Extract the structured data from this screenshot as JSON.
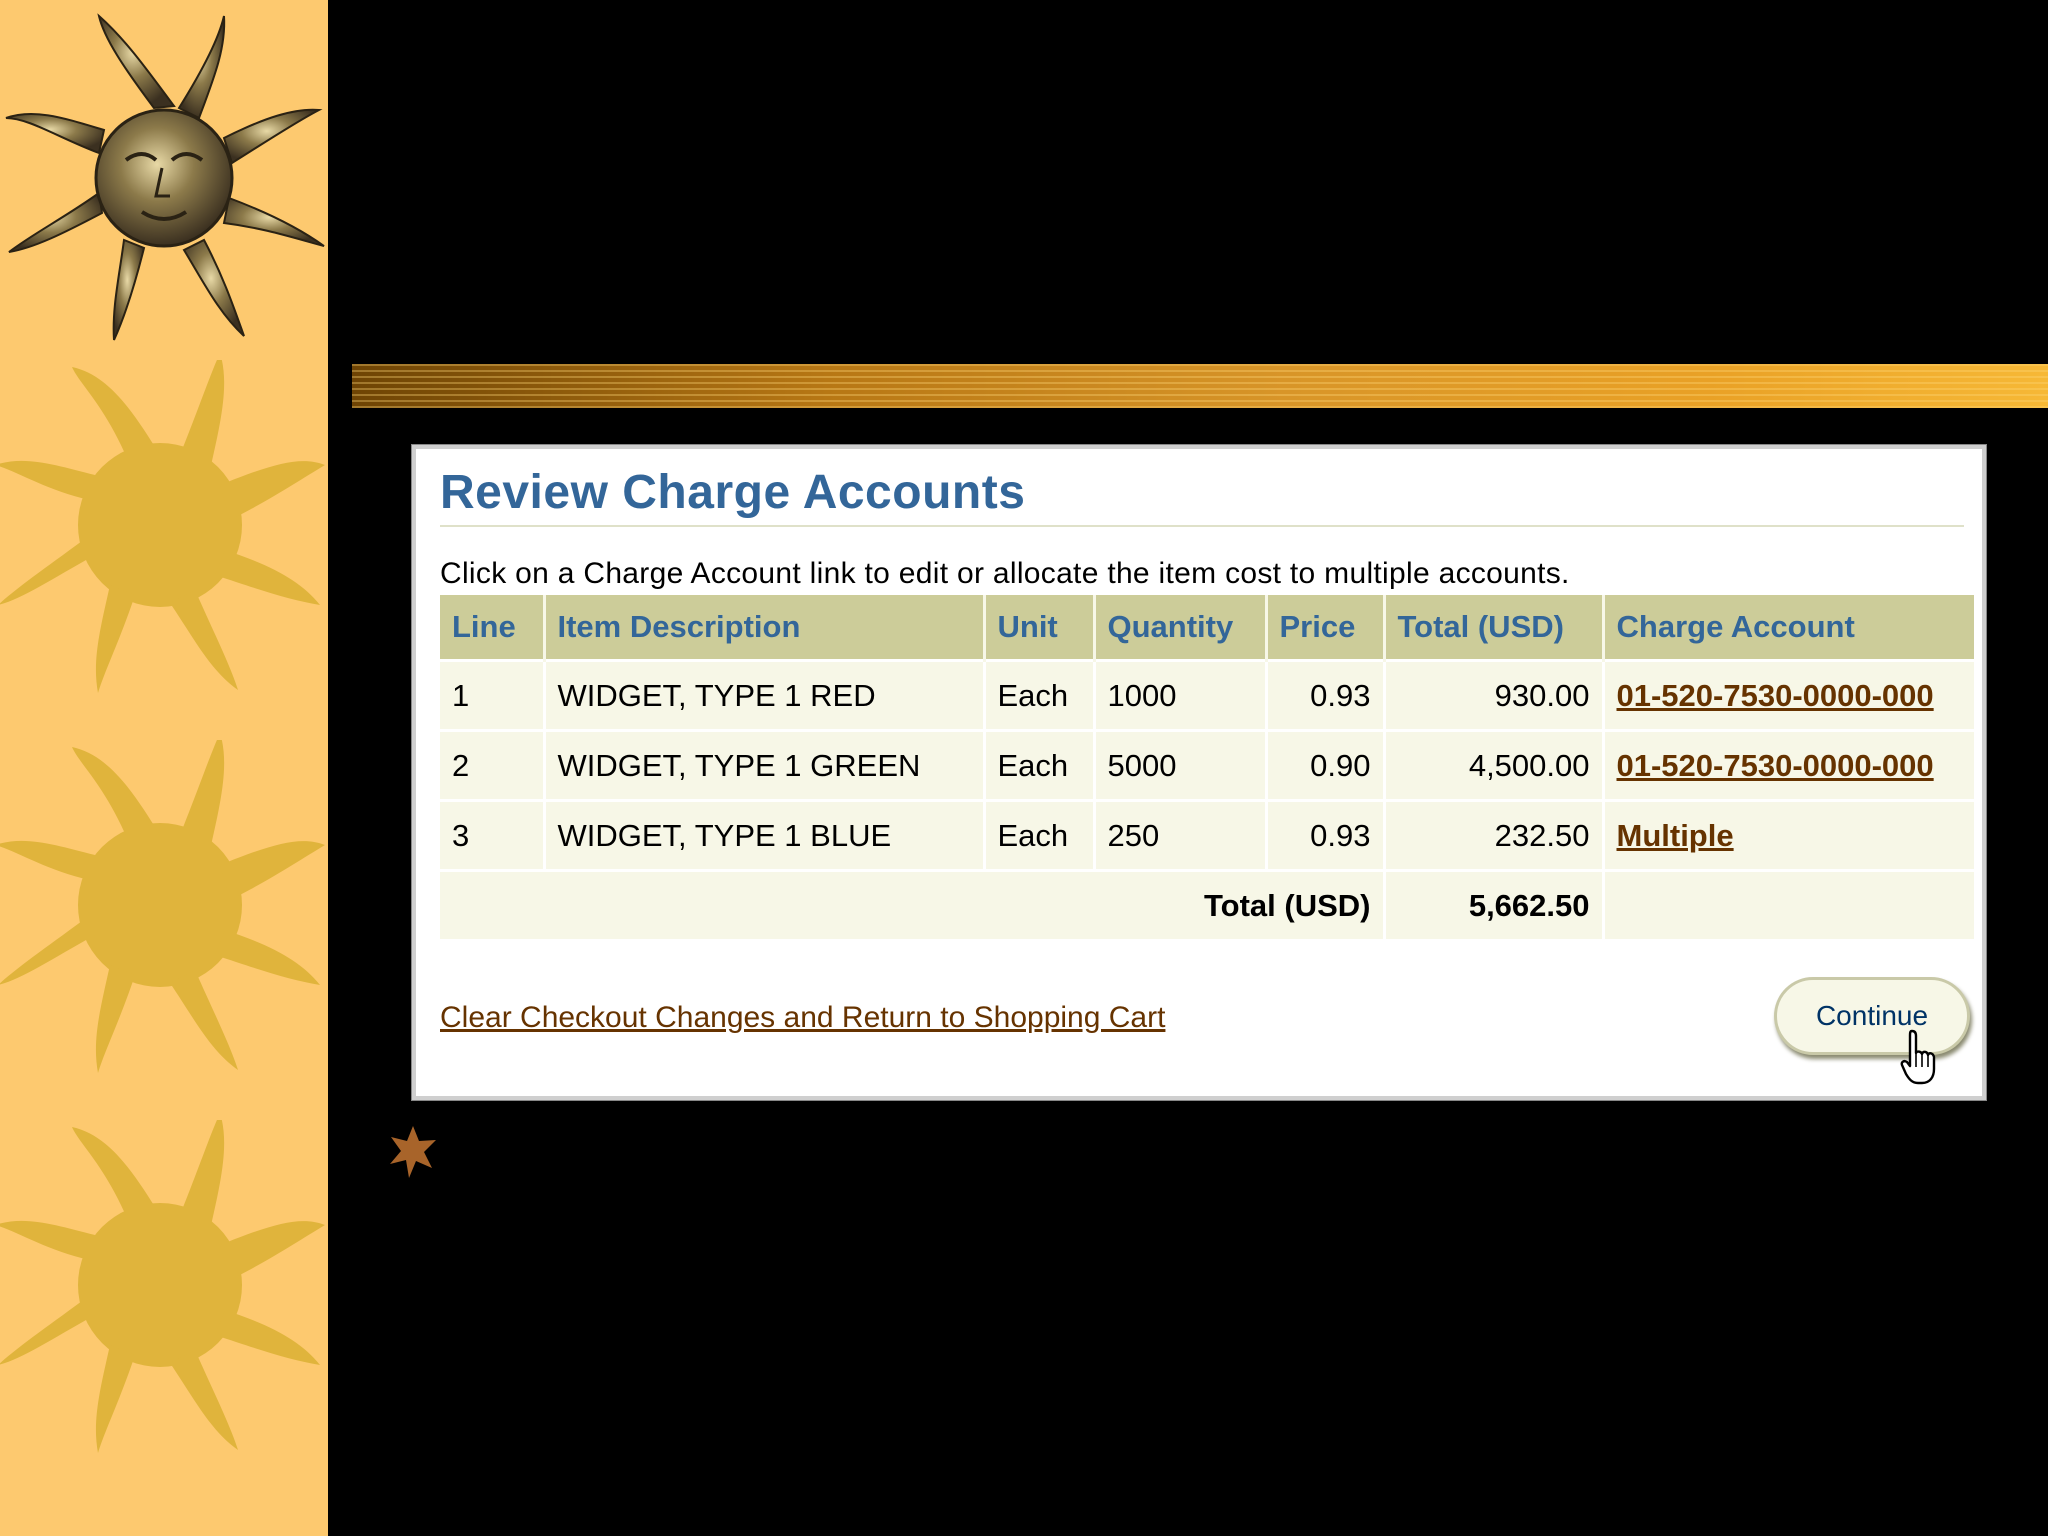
{
  "colors": {
    "strip": "#fdc96f",
    "sun": "#e0b43c",
    "panel_title": "#336699",
    "header_bg": "#cccc99",
    "row_bg": "#f7f7e7",
    "link": "#663300"
  },
  "page": {
    "title": "Review Charge Accounts",
    "instructions": "Click on a Charge Account link to edit or allocate the item cost to multiple accounts."
  },
  "table": {
    "headers": [
      "Line",
      "Item Description",
      "Unit",
      "Quantity",
      "Price",
      "Total (USD)",
      "Charge Account"
    ],
    "rows": [
      {
        "line": "1",
        "description": "WIDGET, TYPE 1 RED",
        "unit": "Each",
        "quantity": "1000",
        "price": "0.93",
        "total": "930.00",
        "account": "01-520-7530-0000-000"
      },
      {
        "line": "2",
        "description": "WIDGET, TYPE 1 GREEN",
        "unit": "Each",
        "quantity": "5000",
        "price": "0.90",
        "total": "4,500.00",
        "account": "01-520-7530-0000-000"
      },
      {
        "line": "3",
        "description": "WIDGET, TYPE 1 BLUE",
        "unit": "Each",
        "quantity": "250",
        "price": "0.93",
        "total": "232.50",
        "account": "Multiple"
      }
    ],
    "total_label": "Total (USD)",
    "total_value": "5,662.50"
  },
  "actions": {
    "clear_link": "Clear Checkout Changes and Return to Shopping Cart",
    "continue_label": "Continue"
  },
  "icons": {
    "decorations": [
      "sun-face-icon",
      "sun-icon",
      "sun-icon",
      "sun-icon"
    ],
    "bullet": "star-bullet-icon",
    "cursor": "hand-pointer-cursor"
  }
}
